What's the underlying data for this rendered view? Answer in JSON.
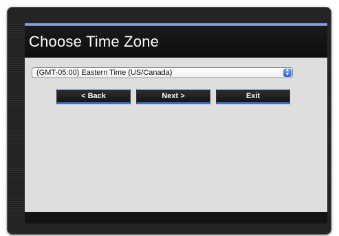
{
  "title": "Choose Time Zone",
  "timezone_select": {
    "selected": "(GMT-05:00) Eastern Time (US/Canada)"
  },
  "buttons": {
    "back": "< Back",
    "next": "Next >",
    "exit": "Exit"
  },
  "colors": {
    "accent_blue": "#3e6fc4",
    "title_stripe": "#7a9be0",
    "content_bg": "#dedede",
    "frame_dark": "#222222"
  }
}
